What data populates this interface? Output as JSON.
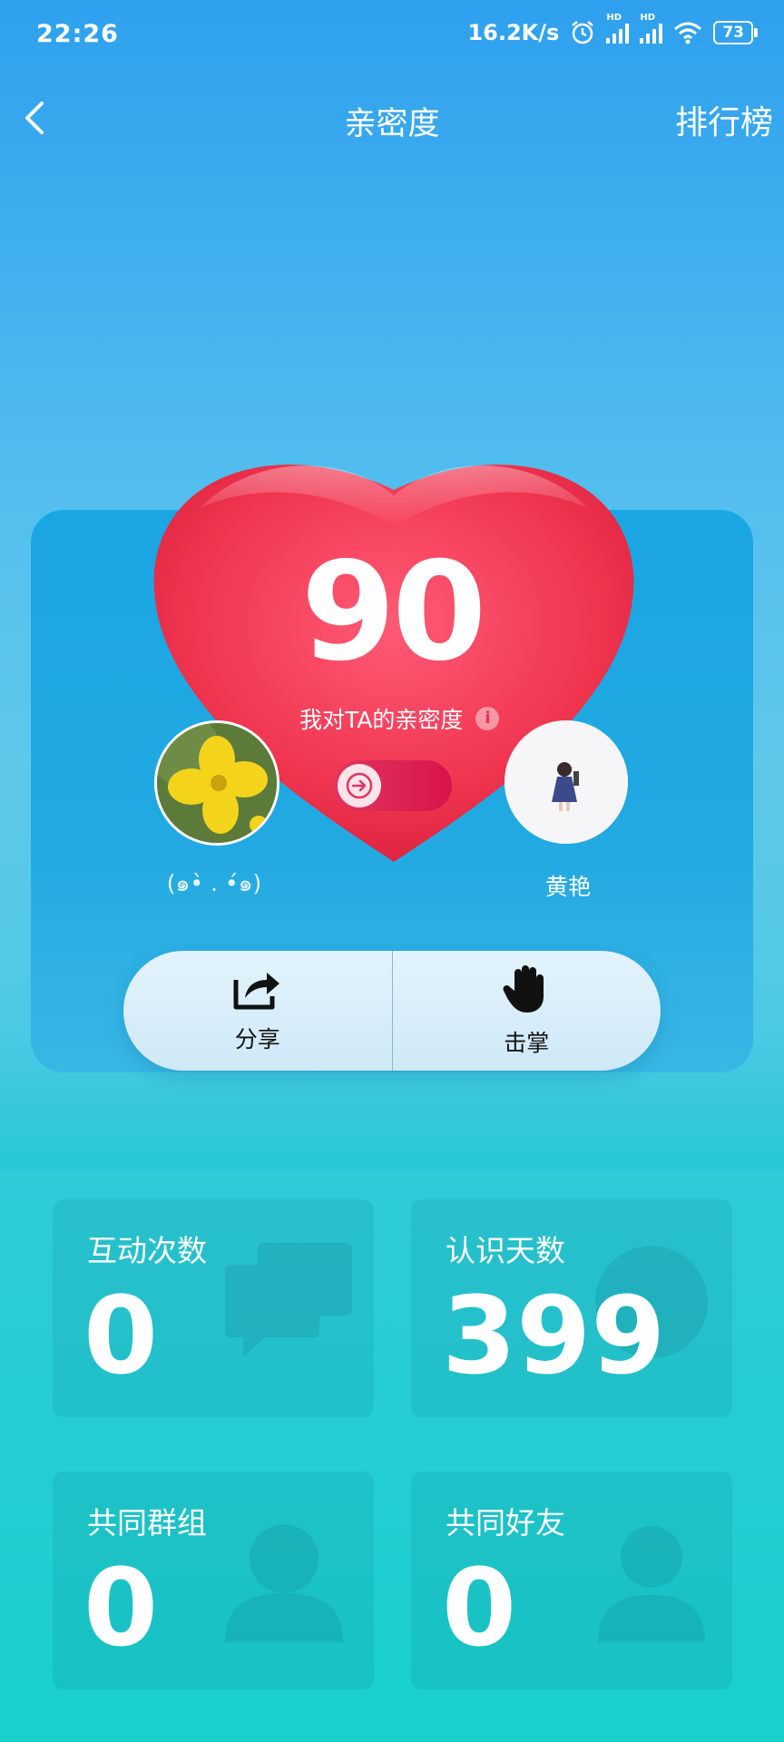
{
  "status_bar": {
    "time": "22:26",
    "net_speed": "16.2K/s",
    "signal_hd_1": "HD",
    "signal_hd_2": "HD",
    "battery": "73",
    "icons": [
      "alarm-icon",
      "signal-icon",
      "signal-icon",
      "wifi-icon",
      "battery-icon"
    ]
  },
  "nav": {
    "back_icon": "back-arrow-icon",
    "title": "亲密度",
    "rank_label": "排行榜"
  },
  "intimacy": {
    "score": "90",
    "label": "我对TA的亲密度",
    "info_icon": "i",
    "direction_icon": "arrow-right-icon",
    "heart_color": "#ee3256"
  },
  "users": {
    "me": {
      "name": "(๑•̀ . •́๑)",
      "avatar": "yellow-flower-photo"
    },
    "ta": {
      "name": "黄艳",
      "avatar": "girl-illustration"
    }
  },
  "actions": [
    {
      "label": "分享",
      "icon": "share-icon"
    },
    {
      "label": "击掌",
      "icon": "high-five-hand-icon"
    }
  ],
  "stats": [
    {
      "label": "互动次数",
      "value": "0",
      "icon": "chat-bubbles-icon"
    },
    {
      "label": "认识天数",
      "value": "399",
      "icon": "clock-icon"
    },
    {
      "label": "共同群组",
      "value": "0",
      "icon": "group-icon"
    },
    {
      "label": "共同好友",
      "value": "0",
      "icon": "person-icon"
    }
  ]
}
